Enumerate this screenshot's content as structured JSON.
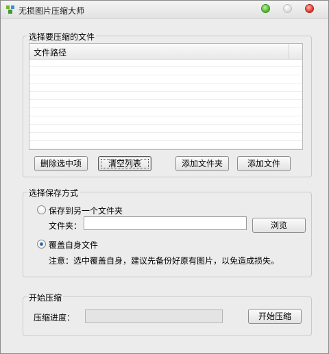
{
  "window": {
    "title": "无损图片压缩大师"
  },
  "files_group": {
    "title": "选择要压缩的文件",
    "column_header": "文件路径",
    "rows": [],
    "buttons": {
      "delete_selected": "删除选中项",
      "clear_list": "清空列表",
      "add_folder": "添加文件夹",
      "add_file": "添加文件"
    }
  },
  "save_group": {
    "title": "选择保存方式",
    "option_other_folder": "保存到另一个文件夹",
    "folder_label": "文件夹：",
    "folder_value": "",
    "browse": "浏览",
    "option_overwrite": "覆盖自身文件",
    "selected_option": "overwrite",
    "note": "注意：选中覆盖自身，建议先备份好原有图片，以免造成损失。"
  },
  "compress_group": {
    "title": "开始压缩",
    "progress_label": "压缩进度：",
    "progress_fraction": 0,
    "start_button": "开始压缩"
  },
  "colors": {
    "accent": "#2a6fb3",
    "minimize": "#4cb62a",
    "close": "#e2362a"
  }
}
